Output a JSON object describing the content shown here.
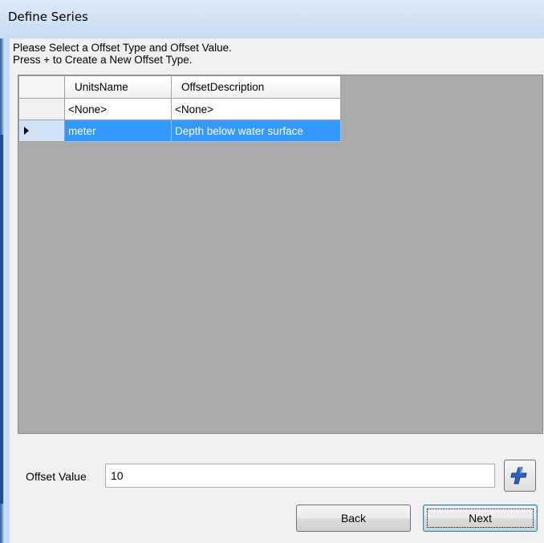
{
  "window": {
    "title": "Define Series"
  },
  "instructions": {
    "line1": "Please Select a Offset Type and Offset Value.",
    "line2": "Press + to Create a New Offset Type."
  },
  "grid": {
    "columns": [
      "UnitsName",
      "OffsetDescription"
    ],
    "rows": [
      {
        "units": "<None>",
        "description": "<None>",
        "selected": false
      },
      {
        "units": "meter",
        "description": "Depth below water surface",
        "selected": true
      }
    ]
  },
  "offset": {
    "label": "Offset Value",
    "value": "10"
  },
  "buttons": {
    "back": "Back",
    "next": "Next"
  },
  "icons": {
    "add": "plus-icon"
  },
  "colors": {
    "selection": "#3399ff",
    "grid_background": "#ababab"
  }
}
